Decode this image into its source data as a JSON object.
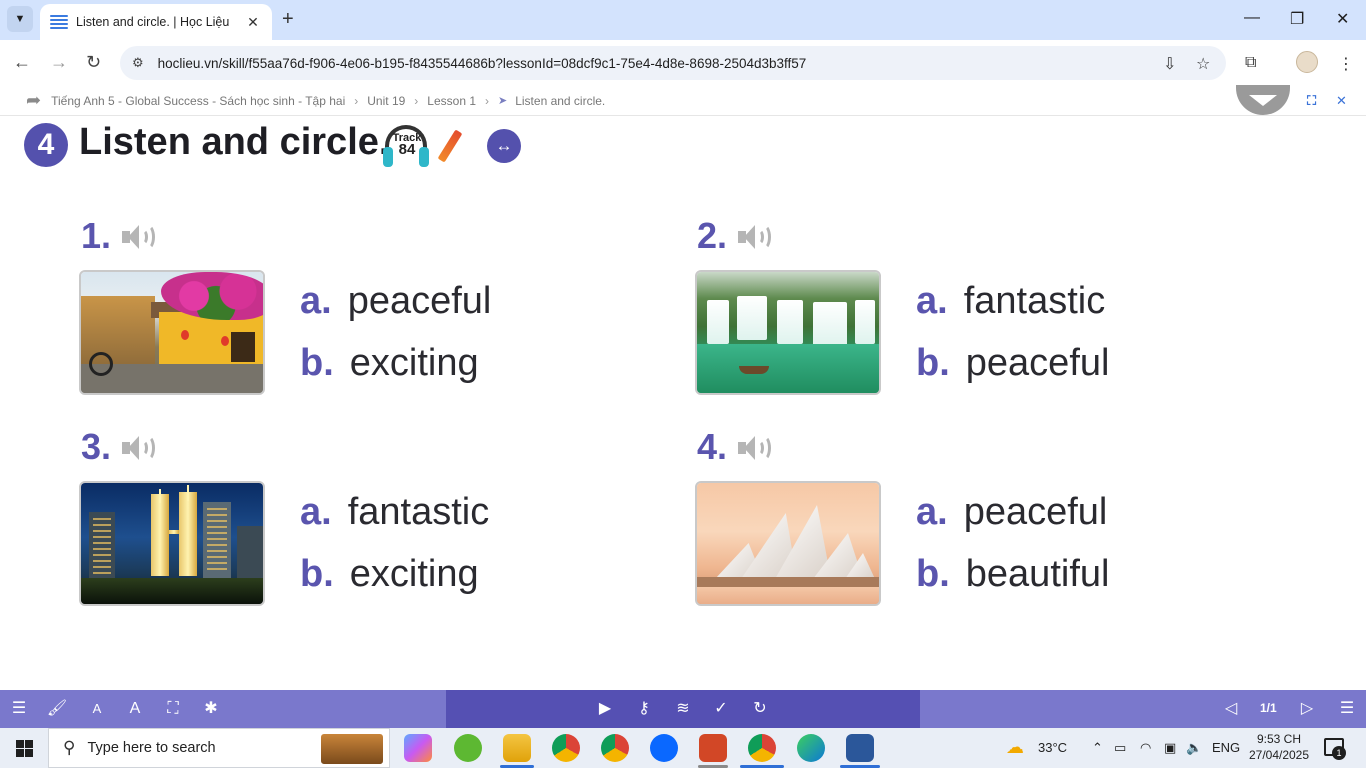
{
  "browser": {
    "tab_title": "Listen and circle. | Học Liệu",
    "url": "hoclieu.vn/skill/f55aa76d-f906-4e06-b195-f8435544686b?lessonId=08dcf9c1-75e4-4d8e-8698-2504d3b3ff57"
  },
  "breadcrumb": {
    "items": [
      "Tiếng Anh 5 - Global Success - Sách học sinh - Tập hai",
      "Unit 19",
      "Lesson 1",
      "Listen and circle."
    ]
  },
  "exercise": {
    "number": "4",
    "title": "Listen and circle.",
    "track_label": "Track",
    "track_number": "84",
    "questions": [
      {
        "number": "1.",
        "image": "Hoi An old town street",
        "options": [
          {
            "letter": "a.",
            "text": "peaceful"
          },
          {
            "letter": "b.",
            "text": "exciting"
          }
        ]
      },
      {
        "number": "2.",
        "image": "Ban Gioc waterfall",
        "options": [
          {
            "letter": "a.",
            "text": "fantastic"
          },
          {
            "letter": "b.",
            "text": "peaceful"
          }
        ]
      },
      {
        "number": "3.",
        "image": "Petronas Twin Towers at night",
        "options": [
          {
            "letter": "a.",
            "text": "fantastic"
          },
          {
            "letter": "b.",
            "text": "exciting"
          }
        ]
      },
      {
        "number": "4.",
        "image": "Sydney Opera House at sunset",
        "options": [
          {
            "letter": "a.",
            "text": "peaceful"
          },
          {
            "letter": "b.",
            "text": "beautiful"
          }
        ]
      }
    ]
  },
  "lesson_toolbar": {
    "page": "1/1",
    "accent": "#7a78cc",
    "accent_dark": "#5550b3"
  },
  "taskbar": {
    "search_placeholder": "Type here to search",
    "weather": "33°C",
    "language": "ENG",
    "time": "9:53 CH",
    "date": "27/04/2025",
    "notifications": "1"
  }
}
